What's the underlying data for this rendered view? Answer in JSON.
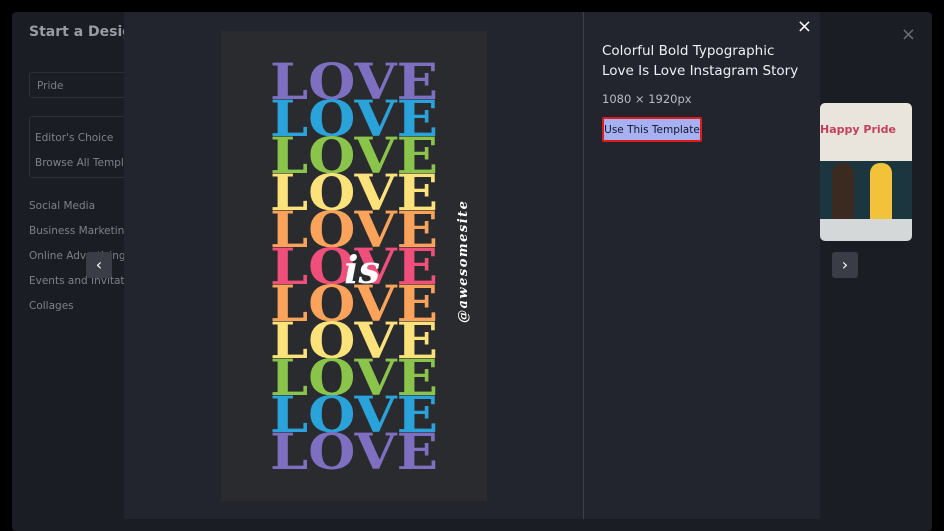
{
  "background": {
    "title": "Start a Design",
    "search_value": "Pride",
    "filters": [
      "Editor's Choice",
      "Browse All Templates"
    ],
    "categories": [
      "Social Media",
      "Business Marketing",
      "Online Advertising",
      "Events and Invitations",
      "Collages"
    ],
    "card_title": "Happy Pride",
    "close_symbol": "×"
  },
  "modal": {
    "template_title": "Colorful Bold Typographic Love Is Love Instagram Story",
    "dimensions": "1080 × 1920px",
    "use_button_label": "Use This Template",
    "close_symbol": "×",
    "prev_symbol": "‹",
    "next_symbol": "›"
  },
  "poster": {
    "word": "LOVE",
    "overlay_word": "is",
    "handle": "@awesomesite",
    "background_color": "#2a2b2e",
    "row_colors": [
      "#7f6fc0",
      "#29a3d9",
      "#8bc44b",
      "#fce27a",
      "#fba35b",
      "#ef4f7a",
      "#fba35b",
      "#fce27a",
      "#8bc44b",
      "#29a3d9",
      "#7f6fc0"
    ]
  },
  "colors": {
    "button_bg": "#a7b1f2",
    "button_highlight": "#e01a1a",
    "modal_bg": "#22252e"
  }
}
